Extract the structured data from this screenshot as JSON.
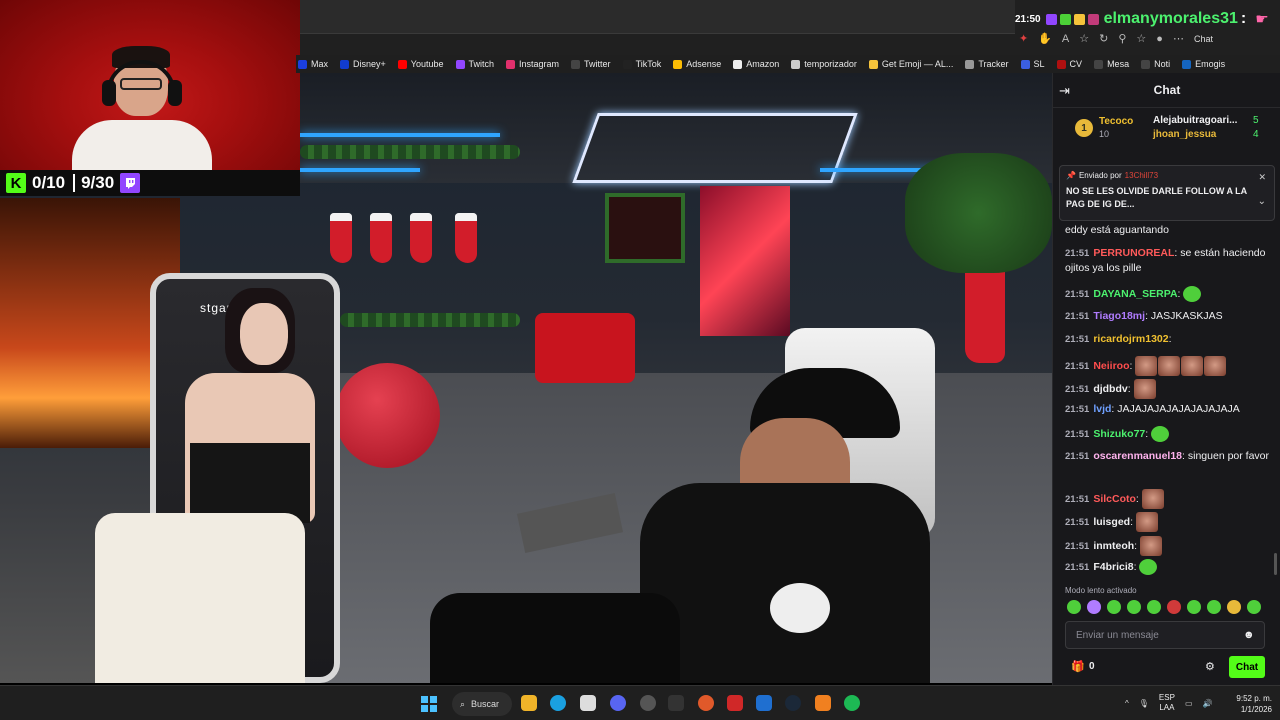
{
  "overlay": {
    "time": "21:50",
    "username": "elmanymorales31",
    "colon": ":",
    "chat_label": "Chat"
  },
  "bookmarks": [
    {
      "label": "Max",
      "icon": "max-icon",
      "color": "#1b3fe0"
    },
    {
      "label": "Disney+",
      "icon": "disney-icon",
      "color": "#113ccf"
    },
    {
      "label": "Youtube",
      "icon": "youtube-icon",
      "color": "#ff0000"
    },
    {
      "label": "Twitch",
      "icon": "twitch-icon",
      "color": "#9146ff"
    },
    {
      "label": "Instagram",
      "icon": "instagram-icon",
      "color": "#e1306c"
    },
    {
      "label": "Twitter",
      "icon": "x-icon",
      "color": "#444444"
    },
    {
      "label": "TikTok",
      "icon": "tiktok-icon",
      "color": "#222222"
    },
    {
      "label": "Adsense",
      "icon": "adsense-icon",
      "color": "#fbbc04"
    },
    {
      "label": "Amazon",
      "icon": "amazon-icon",
      "color": "#eeeeee"
    },
    {
      "label": "temporizador",
      "icon": "timer-icon",
      "color": "#cccccc"
    },
    {
      "label": "Get Emoji — AL...",
      "icon": "emoji-icon",
      "color": "#f5c33b"
    },
    {
      "label": "Tracker",
      "icon": "tracker-icon",
      "color": "#999999"
    },
    {
      "label": "SL",
      "icon": "sl-icon",
      "color": "#3b5fe0"
    },
    {
      "label": "CV",
      "icon": "cv-icon",
      "color": "#b01010"
    },
    {
      "label": "Mesa",
      "icon": "k-icon",
      "color": "#444444"
    },
    {
      "label": "Noti",
      "icon": "k-icon",
      "color": "#444444"
    },
    {
      "label": "Emogis",
      "icon": "v-icon",
      "color": "#1565c0"
    }
  ],
  "counter": {
    "kick_logo": "K",
    "kick_count": "0/10",
    "twitch_count": "9/30",
    "twitch_logo": "⌂"
  },
  "stream": {
    "chair_brand": "stgam"
  },
  "chat": {
    "title": "Chat",
    "leaderboard": {
      "rank1": "1",
      "top_name": "Tecoco",
      "top_count": "10",
      "second_name": "Alejabuitragoari...",
      "second_count": "5",
      "third_name": "jhoan_jessua",
      "third_count": "4"
    },
    "pinned": {
      "label": "Enviado por",
      "user": "13Chill73",
      "text": "NO SE LES OLVIDE DARLE FOLLOW A LA PAG DE IG DE..."
    },
    "messages": [
      {
        "time": "",
        "user": "",
        "color": "#efeff1",
        "text": "eddy está aguantando",
        "emotes": 0,
        "etype": ""
      },
      {
        "time": "21:51",
        "user": "PERRUNOREAL",
        "color": "#ff5a5a",
        "text": "se están haciendo ojitos ya los pille",
        "emotes": 0,
        "etype": ""
      },
      {
        "time": "21:51",
        "user": "DAYANA_SERPA",
        "color": "#4cf16e",
        "text": "",
        "emotes": 1,
        "etype": "green"
      },
      {
        "time": "21:51",
        "user": "Tiago18mj",
        "color": "#b07cff",
        "text": "JASJKASKJAS",
        "emotes": 0,
        "etype": ""
      },
      {
        "time": "21:51",
        "user": "ricardojrm1302",
        "color": "#f0c030",
        "text": "",
        "emotes": 0,
        "etype": ""
      },
      {
        "time": "21:51",
        "user": "Neiiroo",
        "color": "#ff4d4d",
        "text": "",
        "emotes": 4,
        "etype": "face"
      },
      {
        "time": "21:51",
        "user": "djdbdv",
        "color": "#efeff1",
        "text": "",
        "emotes": 1,
        "etype": "face"
      },
      {
        "time": "21:51",
        "user": "lvjd",
        "color": "#6fa0ff",
        "text": "JAJAJAJAJAJAJAJAJAJA",
        "emotes": 0,
        "etype": ""
      },
      {
        "time": "21:51",
        "user": "Shizuko77",
        "color": "#4cf16e",
        "text": "",
        "emotes": 1,
        "etype": "green"
      },
      {
        "time": "21:51",
        "user": "oscarenmanuel18",
        "color": "#ffb3ee",
        "text": "singuen por favor",
        "emotes": 0,
        "etype": ""
      },
      {
        "time": "21:51",
        "user": "SilcCoto",
        "color": "#ff5a5a",
        "text": "",
        "emotes": 1,
        "etype": "face"
      },
      {
        "time": "21:51",
        "user": "luisged",
        "color": "#efeff1",
        "text": "",
        "emotes": 1,
        "etype": "face"
      },
      {
        "time": "21:51",
        "user": "inmteoh",
        "color": "#efeff1",
        "text": "",
        "emotes": 1,
        "etype": "face"
      },
      {
        "time": "21:51",
        "user": "F4brici8",
        "color": "#efeff1",
        "text": "",
        "emotes": 1,
        "etype": "green"
      }
    ],
    "slow_mode": "Modo lento activado",
    "input_placeholder": "Enviar un mensaje",
    "points": "0",
    "send_label": "Chat"
  },
  "taskbar": {
    "search_label": "Buscar",
    "lang_top": "ESP",
    "lang_bottom": "LAA",
    "time": "9:52 p. m.",
    "date": "1/1/2026"
  }
}
